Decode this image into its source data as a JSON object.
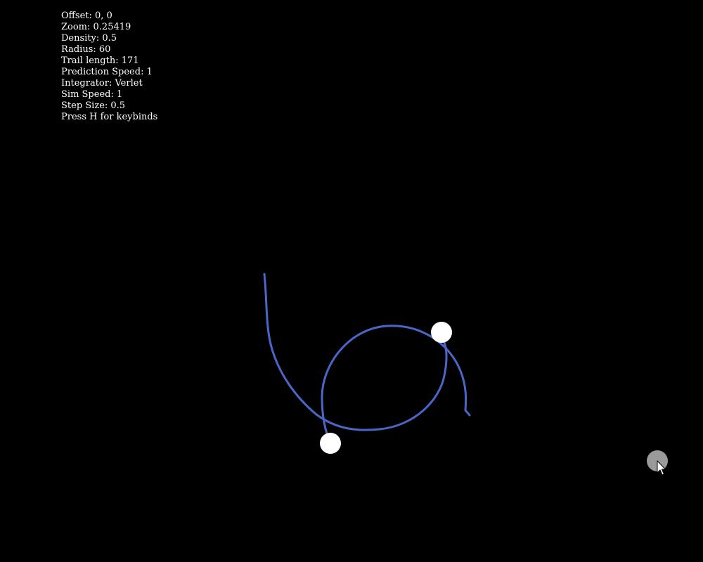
{
  "hud": {
    "lines": [
      "Offset: 0, 0",
      "Zoom: 0.25419",
      "Density: 0.5",
      "Radius: 60",
      "Trail length: 171",
      "Prediction Speed: 1",
      "Integrator: Verlet",
      "Sim Speed: 1",
      "Step Size: 0.5",
      "Press H for keybinds"
    ]
  },
  "scene": {
    "background_color": "#000000",
    "trail_color": "#4a67c8",
    "body_color": "#ffffff",
    "cursor_ghost_color": "#9a9a9a",
    "icons": [
      "mouse-pointer-icon"
    ]
  }
}
